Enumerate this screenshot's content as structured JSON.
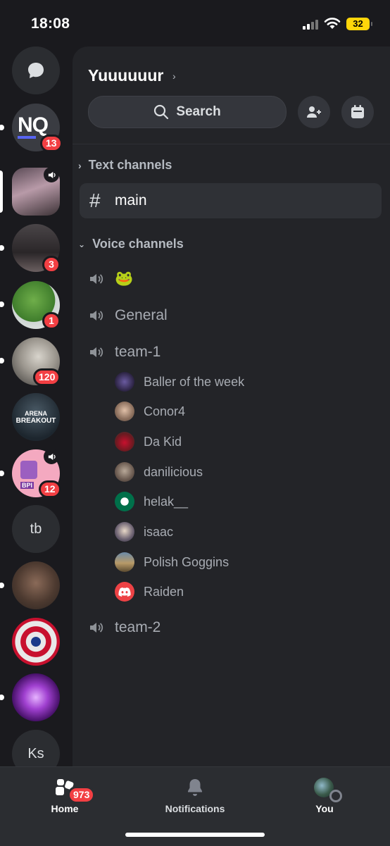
{
  "status_bar": {
    "time": "18:08",
    "battery": "32"
  },
  "rail": {
    "servers": [
      {
        "abbr": "NQ",
        "badge": "13"
      },
      {
        "badge": ""
      },
      {
        "badge": "3"
      },
      {
        "badge": "1"
      },
      {
        "badge": "120"
      },
      {
        "label_line1": "ARENA",
        "label_line2": "BREAKOUT"
      },
      {
        "badge": "12",
        "tag": "BPI"
      },
      {
        "abbr": "tb"
      },
      {
        "badge": ""
      },
      {
        "badge": ""
      },
      {
        "badge": ""
      },
      {
        "abbr": "Ks"
      }
    ]
  },
  "panel": {
    "server_name": "Yuuuuuur",
    "search_label": "Search",
    "text_section": "Text channels",
    "text_channels": [
      "main"
    ],
    "voice_section": "Voice channels",
    "voice_channels": [
      "🐸",
      "General",
      "team-1",
      "team-2"
    ],
    "members": [
      "Baller of the week",
      "Conor4",
      "Da Kid",
      "danilicious",
      "helak__",
      "isaac",
      "Polish Goggins",
      "Raiden"
    ]
  },
  "tabbar": {
    "home": "Home",
    "home_badge": "973",
    "notifications": "Notifications",
    "you": "You"
  },
  "colors": {
    "badge": "#f23f43",
    "accent": "#5865f2",
    "background": "#1a1a1e"
  }
}
